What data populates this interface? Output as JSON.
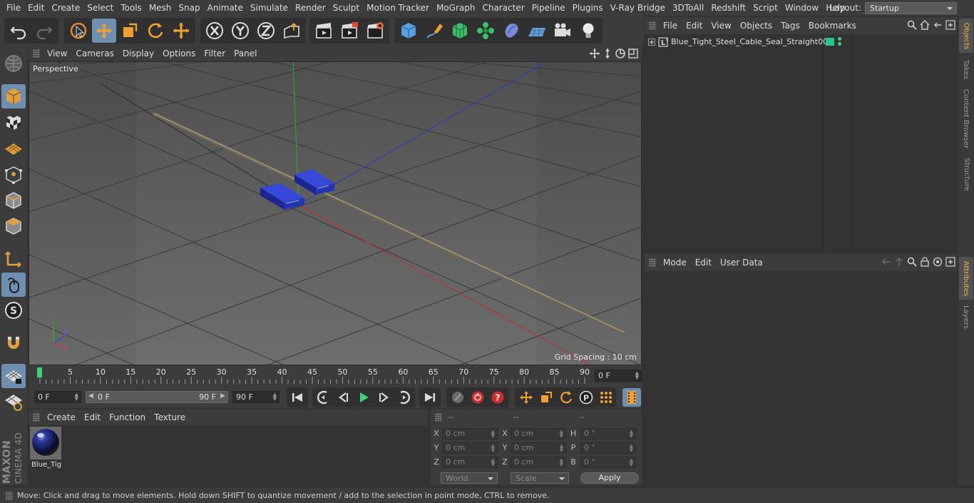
{
  "menubar": {
    "items": [
      "File",
      "Edit",
      "Create",
      "Select",
      "Tools",
      "Mesh",
      "Snap",
      "Animate",
      "Simulate",
      "Render",
      "Sculpt",
      "Motion Tracker",
      "MoGraph",
      "Character",
      "Pipeline",
      "Plugins",
      "V-Ray Bridge",
      "3DToAll",
      "Redshift",
      "Script",
      "Window",
      "Help"
    ],
    "layout_label": "Layout:",
    "layout_value": "Startup"
  },
  "viewport": {
    "menu": [
      "View",
      "Cameras",
      "Display",
      "Options",
      "Filter",
      "Panel"
    ],
    "label": "Perspective",
    "grid_spacing": "Grid Spacing : 10 cm",
    "axis_labels": [
      "Y",
      "Z",
      "X"
    ]
  },
  "timeline": {
    "ticks": [
      "0",
      "5",
      "10",
      "15",
      "20",
      "25",
      "30",
      "35",
      "40",
      "45",
      "50",
      "55",
      "60",
      "65",
      "70",
      "75",
      "80",
      "85",
      "90"
    ],
    "current_frame": "0 F"
  },
  "playback": {
    "start_field": "0 F",
    "range_start": "0 F",
    "range_end": "90 F",
    "end_field": "90 F"
  },
  "materials": {
    "menu": [
      "Create",
      "Edit",
      "Function",
      "Texture"
    ],
    "items": [
      {
        "name": "Blue_Tig"
      }
    ]
  },
  "coordinates": {
    "headers": [
      "--",
      "--",
      "--"
    ],
    "rows": [
      {
        "a1": "X",
        "v1": "0 cm",
        "a2": "X",
        "v2": "0 cm",
        "a3": "H",
        "v3": "0 °"
      },
      {
        "a1": "Y",
        "v1": "0 cm",
        "a2": "Y",
        "v2": "0 cm",
        "a3": "P",
        "v3": "0 °"
      },
      {
        "a1": "Z",
        "v1": "0 cm",
        "a2": "Z",
        "v2": "0 cm",
        "a3": "B",
        "v3": "0 °"
      }
    ],
    "space": "World",
    "mode": "Scale",
    "apply": "Apply"
  },
  "objects": {
    "menu": [
      "File",
      "Edit",
      "View",
      "Objects",
      "Tags",
      "Bookmarks"
    ],
    "items": [
      {
        "name": "Blue_Tight_Steel_Cable_Seal_Straight001"
      }
    ]
  },
  "attributes": {
    "menu": [
      "Mode",
      "Edit",
      "User Data"
    ]
  },
  "right_tabs": [
    "Objects",
    "Takes",
    "Content Browser",
    "Structure",
    "Attributes",
    "Layers"
  ],
  "brand": {
    "line1": "MAXON",
    "line2": "CINEMA 4D"
  },
  "status": "Move: Click and drag to move elements. Hold down SHIFT to quantize movement / add to the selection in point mode, CTRL to remove.",
  "colors": {
    "accent": "#6f8fb0",
    "active_tab": "#f0b050",
    "seal_blue": "#2435b8",
    "object_tag": "#27c98a"
  }
}
